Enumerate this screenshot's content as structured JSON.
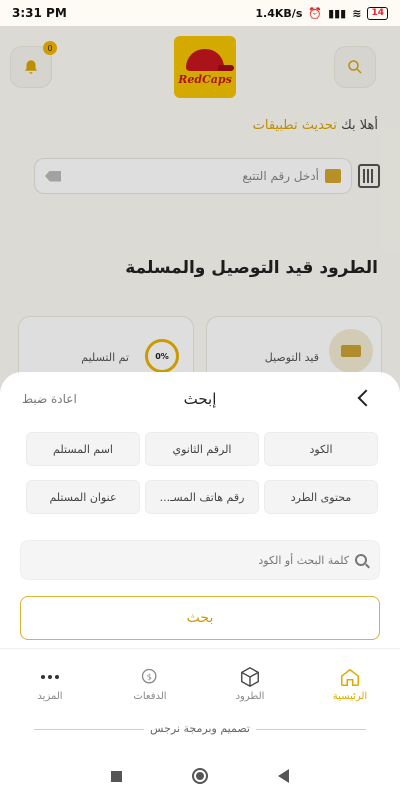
{
  "status_bar": {
    "time": "3:31 PM",
    "network_speed": "1.4KB/s",
    "battery": "14"
  },
  "header": {
    "notification_count": "0",
    "logo_text": "RedCaps"
  },
  "greeting": {
    "prefix": "أهلا بك",
    "name": "تحديث تطبيقات"
  },
  "tracking": {
    "placeholder": "أدخل رقم التتبع"
  },
  "section_title": "الطرود قيد التوصيل والمسلمة",
  "cards": [
    {
      "label": "تم التسليم",
      "percent": "0%"
    },
    {
      "label": "قيد التوصيل"
    }
  ],
  "sheet": {
    "title": "إبحث",
    "reset": "اعادة ضبط",
    "chips": [
      "الكود",
      "الرقم الثانوي",
      "اسم المستلم",
      "محتوى الطرد",
      "رقم هاتف المسـ...",
      "عنوان المستلم"
    ],
    "search_placeholder": "كلمة البحث أو الكود",
    "search_button": "بحث"
  },
  "bottom_nav": [
    {
      "label": "الرئيسية",
      "icon": "home-icon",
      "active": true
    },
    {
      "label": "الطرود",
      "icon": "box-icon",
      "active": false
    },
    {
      "label": "الدفعات",
      "icon": "payments-icon",
      "active": false
    },
    {
      "label": "المزيد",
      "icon": "more-icon",
      "active": false
    }
  ],
  "footer": "تصميم وبرمجة نرجس",
  "colors": {
    "accent": "#e0a800",
    "brand_yellow": "#f5c400",
    "brand_red": "#c4161c"
  }
}
